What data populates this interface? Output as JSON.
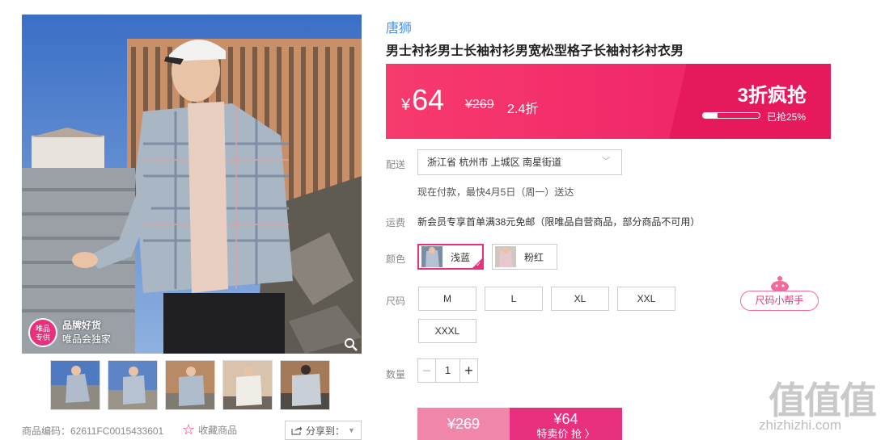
{
  "gallery": {
    "badge_top": "唯品\n专供",
    "badge_title": "品牌好货",
    "badge_sub": "唯品会独家",
    "thumb_count": 5
  },
  "meta": {
    "sku": "商品编码：62611FC0015433601",
    "favorite": "收藏商品",
    "share": "分享到："
  },
  "product": {
    "brand": "唐狮",
    "title": "男士衬衫男士长袖衬衫男宽松型格子长袖衬衫衬衣男"
  },
  "price": {
    "currency": "¥",
    "current": "64",
    "original": "¥269",
    "discount": "2.4折",
    "promo_title": "3折疯抢",
    "progress_text": "已抢25%",
    "progress_fraction": 0.25
  },
  "delivery": {
    "label": "配送",
    "address": "浙江省 杭州市 上城区 南星街道",
    "eta": "现在付款，最快4月5日（周一）送达"
  },
  "shipping": {
    "label": "运费",
    "text": "新会员专享首单满38元免邮（限唯品自营商品，部分商品不可用）"
  },
  "color": {
    "label": "颜色",
    "options": [
      "浅蓝",
      "粉红"
    ],
    "selected": "浅蓝"
  },
  "size": {
    "label": "尺码",
    "options": [
      "M",
      "L",
      "XL",
      "XXL",
      "XXXL"
    ],
    "helper": "尺码小帮手"
  },
  "quantity": {
    "label": "数量",
    "value": "1",
    "minus": "−",
    "plus": "+"
  },
  "buy": {
    "original": "¥269",
    "price": "¥64",
    "action": "特卖价 抢 〉"
  },
  "watermark": {
    "glyphs": "值值值",
    "url": "zhizhizhi.com"
  },
  "colors": {
    "accent": "#e8307e",
    "banner": "#f1296a",
    "link": "#4a90e2"
  }
}
